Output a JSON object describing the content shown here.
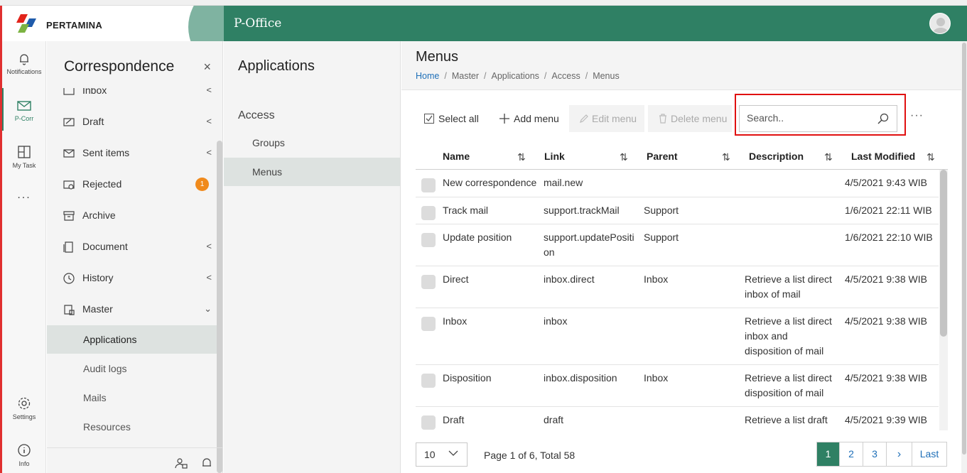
{
  "app": {
    "logo_text": "PERTAMINA",
    "title": "P-Office"
  },
  "rail": {
    "items": [
      {
        "label": "Notifications",
        "icon": "bell-icon"
      },
      {
        "label": "P-Corr",
        "icon": "mail-icon"
      },
      {
        "label": "My Task",
        "icon": "layout-icon"
      },
      {
        "label": "...",
        "icon": "more-icon"
      },
      {
        "label": "Settings",
        "icon": "gear-icon"
      },
      {
        "label": "Info",
        "icon": "info-icon"
      }
    ]
  },
  "nav": {
    "title": "Correspondence",
    "close": "×",
    "items": [
      {
        "label": "Inbox",
        "icon": "inbox-icon"
      },
      {
        "label": "Draft",
        "icon": "draft-icon"
      },
      {
        "label": "Sent items",
        "icon": "sent-icon"
      },
      {
        "label": "Rejected",
        "icon": "rejected-icon",
        "badge": "1"
      },
      {
        "label": "Archive",
        "icon": "archive-icon"
      },
      {
        "label": "Document",
        "icon": "document-icon"
      },
      {
        "label": "History",
        "icon": "history-icon"
      },
      {
        "label": "Master",
        "icon": "master-icon"
      }
    ],
    "sub_items": [
      {
        "label": "Applications",
        "active": true
      },
      {
        "label": "Audit logs"
      },
      {
        "label": "Mails"
      },
      {
        "label": "Resources"
      }
    ]
  },
  "subnav": {
    "title": "Applications",
    "group": "Access",
    "items": [
      {
        "label": "Groups"
      },
      {
        "label": "Menus",
        "active": true
      }
    ]
  },
  "page": {
    "title": "Menus",
    "breadcrumb": [
      "Home",
      "Master",
      "Applications",
      "Access",
      "Menus"
    ]
  },
  "toolbar": {
    "select_all": "Select all",
    "add_menu": "Add menu",
    "edit_menu": "Edit menu",
    "delete_menu": "Delete menu",
    "search_placeholder": "Search..",
    "more": "···"
  },
  "table": {
    "columns": [
      "Name",
      "Link",
      "Parent",
      "Description",
      "Last Modified"
    ],
    "rows": [
      {
        "name": "New correspondence",
        "link": "mail.new",
        "parent": "",
        "description": "",
        "modified": "4/5/2021 9:43 WIB"
      },
      {
        "name": "Track mail",
        "link": "support.trackMail",
        "parent": "Support",
        "description": "",
        "modified": "1/6/2021 22:11 WIB"
      },
      {
        "name": "Update position",
        "link": "support.updatePositi on",
        "parent": "Support",
        "description": "",
        "modified": "1/6/2021 22:10 WIB"
      },
      {
        "name": "Direct",
        "link": "inbox.direct",
        "parent": "Inbox",
        "description": "Retrieve a list direct inbox of mail",
        "modified": "4/5/2021 9:38 WIB"
      },
      {
        "name": "Inbox",
        "link": "inbox",
        "parent": "",
        "description": "Retrieve a list direct inbox and disposition of mail",
        "modified": "4/5/2021 9:38 WIB"
      },
      {
        "name": "Disposition",
        "link": "inbox.disposition",
        "parent": "Inbox",
        "description": "Retrieve a list direct disposition of mail",
        "modified": "4/5/2021 9:38 WIB"
      },
      {
        "name": "Draft",
        "link": "draft",
        "parent": "",
        "description": "Retrieve a list draft",
        "modified": "4/5/2021 9:39 WIB"
      }
    ]
  },
  "pager": {
    "page_size": "10",
    "info": "Page 1 of 6, Total 58",
    "pages": [
      "1",
      "2",
      "3"
    ],
    "next": "›",
    "last": "Last"
  },
  "colors": {
    "brand": "#2f8064",
    "highlight": "#e01010",
    "badge": "#f08a1c",
    "link": "#1e6fb8"
  }
}
